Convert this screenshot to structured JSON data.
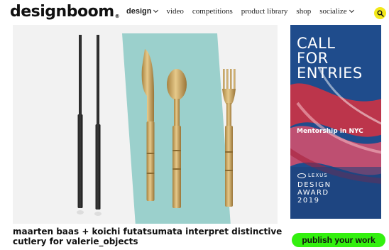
{
  "header": {
    "logo": "designboom",
    "logo_mark": "®",
    "nav": [
      {
        "label": "design",
        "has_dropdown": true,
        "bold": true
      },
      {
        "label": "video",
        "has_dropdown": false
      },
      {
        "label": "competitions",
        "has_dropdown": false
      },
      {
        "label": "product library",
        "has_dropdown": false
      },
      {
        "label": "shop",
        "has_dropdown": false
      },
      {
        "label": "socialize",
        "has_dropdown": true
      }
    ],
    "search_icon": "search-icon",
    "search_button_color": "#f2e81a"
  },
  "hero": {
    "background_color": "#f2f2f2",
    "mat_color": "#9bd0cc",
    "objects": [
      "chopsticks",
      "knife",
      "spoon",
      "fork"
    ]
  },
  "ad": {
    "headline": [
      "CALL",
      "FOR",
      "ENTRIES"
    ],
    "subline": "Mentorship in NYC",
    "brand": "LEXUS",
    "award": [
      "DESIGN",
      "AWARD",
      "2019"
    ]
  },
  "article": {
    "title": "maarten baas + koichi futatsumata interpret distinctive cutlery for valerie_objects"
  },
  "cta": {
    "label": "publish your work",
    "color": "#33f00f"
  }
}
